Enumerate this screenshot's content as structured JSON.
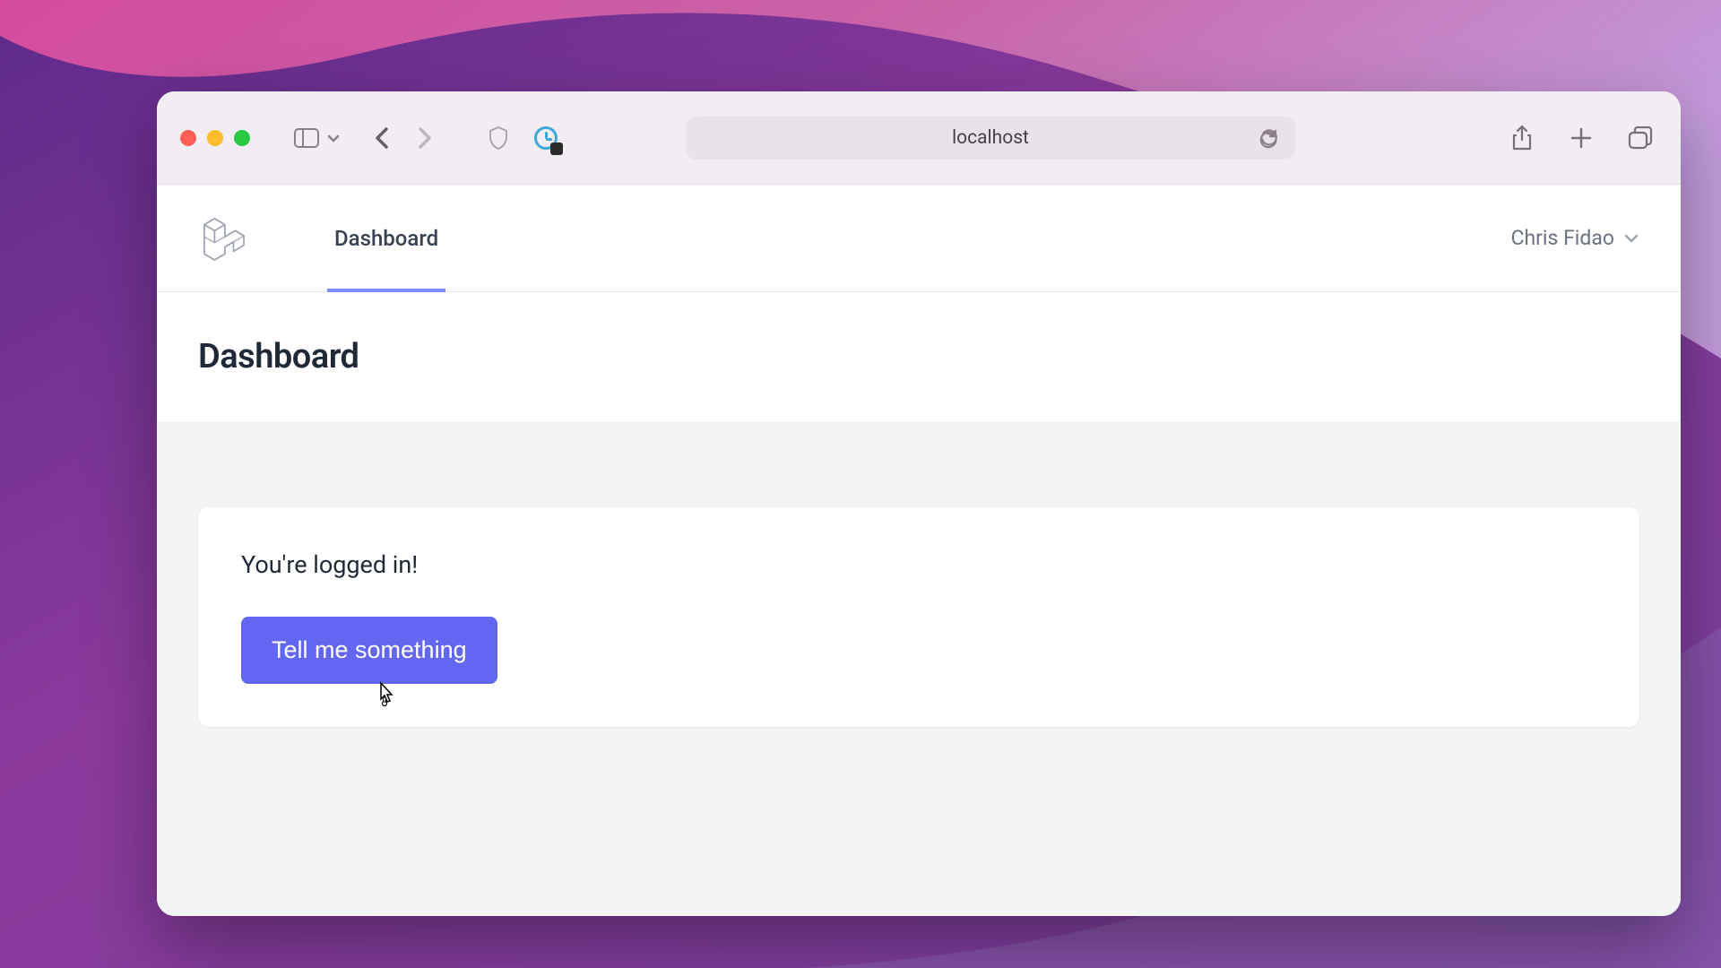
{
  "browser": {
    "address": "localhost"
  },
  "nav": {
    "link_dashboard": "Dashboard",
    "user_name": "Chris Fidao"
  },
  "page": {
    "title": "Dashboard"
  },
  "card": {
    "message": "You're logged in!",
    "button_label": "Tell me something"
  }
}
